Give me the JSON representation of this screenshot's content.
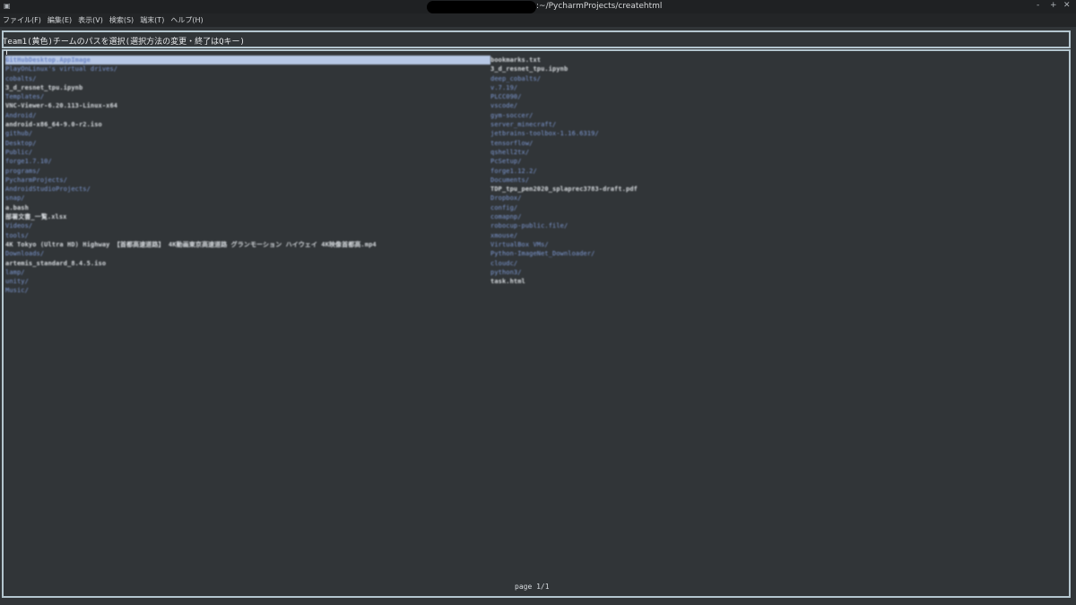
{
  "window": {
    "title": ":~/PycharmProjects/createhtml",
    "app_icon": "terminal-icon",
    "controls": [
      "minimize-icon",
      "maximize-icon",
      "close-icon"
    ],
    "minimize_glyph": "-",
    "maximize_glyph": "+",
    "close_glyph": "✕"
  },
  "menubar": {
    "items": [
      "ファイル(F)",
      "編集(E)",
      "表示(V)",
      "検索(S)",
      "端末(T)",
      "ヘルプ(H)"
    ]
  },
  "header": {
    "text": "Team1(黄色)チームのパスを選択(選択方法の変更・終了はQキー)"
  },
  "listing": {
    "left": [
      {
        "name": "GitHubDesktop.AppImage",
        "kind": "file",
        "selected": true
      },
      {
        "name": "PlayOnLinux's virtual drives/",
        "kind": "dir"
      },
      {
        "name": "cobalts/",
        "kind": "dir"
      },
      {
        "name": "3_d_resnet_tpu.ipynb",
        "kind": "file"
      },
      {
        "name": "Templates/",
        "kind": "dir"
      },
      {
        "name": "VNC-Viewer-6.20.113-Linux-x64",
        "kind": "file"
      },
      {
        "name": "Android/",
        "kind": "dir"
      },
      {
        "name": "android-x86_64-9.0-r2.iso",
        "kind": "file"
      },
      {
        "name": "github/",
        "kind": "dir"
      },
      {
        "name": "Desktop/",
        "kind": "dir"
      },
      {
        "name": "Public/",
        "kind": "dir"
      },
      {
        "name": "forge1.7.10/",
        "kind": "dir"
      },
      {
        "name": "programs/",
        "kind": "dir"
      },
      {
        "name": "PycharmProjects/",
        "kind": "dir"
      },
      {
        "name": "AndroidStudioProjects/",
        "kind": "dir"
      },
      {
        "name": "snap/",
        "kind": "dir"
      },
      {
        "name": "a.bash",
        "kind": "file"
      },
      {
        "name": "部署文書_一覧.xlsx",
        "kind": "file"
      },
      {
        "name": "Videos/",
        "kind": "dir"
      },
      {
        "name": "tools/",
        "kind": "dir"
      },
      {
        "name": "4K Tokyo (Ultra HD) Highway 【首都高速道路】 4K動画東京高速道路 グランモーション ハイウェイ 4K映像首都高.mp4",
        "kind": "file"
      },
      {
        "name": "Downloads/",
        "kind": "dir"
      },
      {
        "name": "artemis_standard_8.4.5.iso",
        "kind": "file"
      },
      {
        "name": "lamp/",
        "kind": "dir"
      },
      {
        "name": "unity/",
        "kind": "dir"
      },
      {
        "name": "Music/",
        "kind": "dir"
      }
    ],
    "right": [
      {
        "name": "bookmarks.txt",
        "kind": "file"
      },
      {
        "name": "3_d_resnet_tpu.ipynb",
        "kind": "file"
      },
      {
        "name": "deep_cobalts/",
        "kind": "dir"
      },
      {
        "name": "v.7.19/",
        "kind": "dir"
      },
      {
        "name": "PLCC090/",
        "kind": "dir"
      },
      {
        "name": "vscode/",
        "kind": "dir"
      },
      {
        "name": "gym-soccer/",
        "kind": "dir"
      },
      {
        "name": "server_minecraft/",
        "kind": "dir"
      },
      {
        "name": "jetbrains-toolbox-1.16.6319/",
        "kind": "dir"
      },
      {
        "name": "tensorflow/",
        "kind": "dir"
      },
      {
        "name": "qshell2tx/",
        "kind": "dir"
      },
      {
        "name": "PcSetup/",
        "kind": "dir"
      },
      {
        "name": "forge1.12.2/",
        "kind": "dir"
      },
      {
        "name": "Documents/",
        "kind": "dir"
      },
      {
        "name": "TDP_tpu_pen2020_splaprec3783-draft.pdf",
        "kind": "file"
      },
      {
        "name": "Dropbox/",
        "kind": "dir"
      },
      {
        "name": "config/",
        "kind": "dir"
      },
      {
        "name": "comapnp/",
        "kind": "dir"
      },
      {
        "name": "robocup-public.file/",
        "kind": "dir"
      },
      {
        "name": "xmouse/",
        "kind": "dir"
      },
      {
        "name": "VirtualBox VMs/",
        "kind": "dir"
      },
      {
        "name": "Python-ImageNet_Downloader/",
        "kind": "dir"
      },
      {
        "name": "cloudc/",
        "kind": "dir"
      },
      {
        "name": "python3/",
        "kind": "dir"
      },
      {
        "name": "task.html",
        "kind": "file"
      }
    ]
  },
  "footer": {
    "page": "page 1/1"
  },
  "colors": {
    "background": "#313538",
    "border": "#b4c6cf",
    "directory": "#7f9bd6",
    "file": "#d8dce0",
    "selection": "#b7c8e6"
  }
}
